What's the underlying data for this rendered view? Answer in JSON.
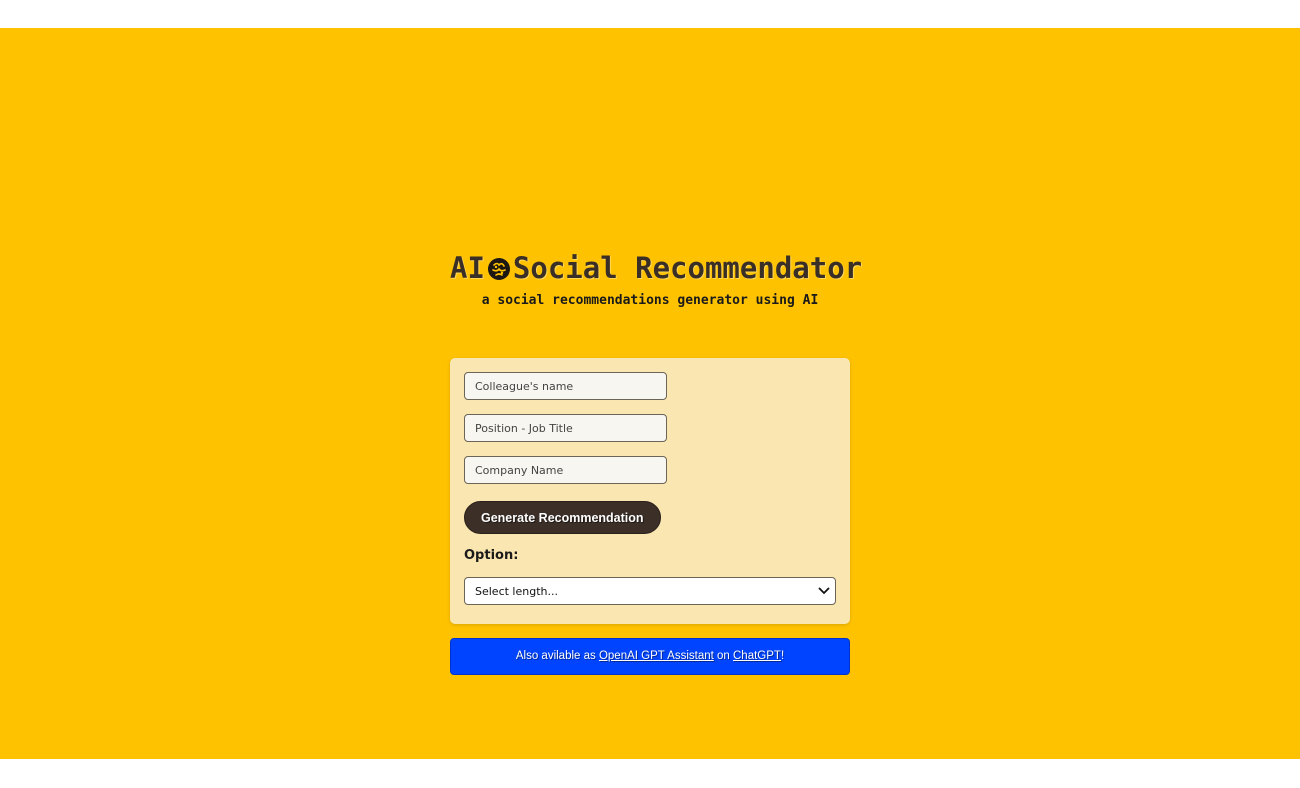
{
  "header": {
    "title_prefix": "AI",
    "title_main": "Social Recommendator",
    "subtitle": "a social recommendations generator using AI",
    "brain_icon": "brain-icon"
  },
  "form": {
    "name_placeholder": "Colleague's name",
    "position_placeholder": "Position - Job Title",
    "company_placeholder": "Company Name",
    "generate_label": "Generate Recommendation",
    "option_label": "Option:",
    "length_select_value": "Select length..."
  },
  "banner": {
    "text_before": "Also avilable as ",
    "link1": "OpenAI GPT Assistant",
    "text_middle": " on ",
    "link2": "ChatGPT",
    "text_after": "!"
  },
  "colors": {
    "background": "#ffc200",
    "card": "#fae6b0",
    "button": "#3c2f27",
    "banner": "#0044ff"
  }
}
